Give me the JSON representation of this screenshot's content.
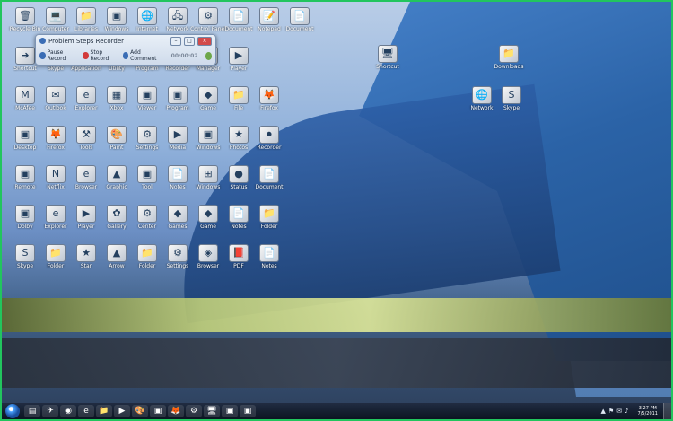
{
  "desktop": {
    "icons": [
      {
        "label": "Recycle Bin",
        "glyph": "🗑"
      },
      {
        "label": "Computer",
        "glyph": "💻"
      },
      {
        "label": "Libraries",
        "glyph": "📁"
      },
      {
        "label": "Windows",
        "glyph": "▣"
      },
      {
        "label": "Internet",
        "glyph": "🌐"
      },
      {
        "label": "Network",
        "glyph": "🖧"
      },
      {
        "label": "Control Panel",
        "glyph": "⚙"
      },
      {
        "label": "Document",
        "glyph": "📄"
      },
      {
        "label": "Notepad",
        "glyph": "📝"
      },
      {
        "label": "Document",
        "glyph": "📄"
      },
      {
        "label": "Shortcut",
        "glyph": "➜"
      },
      {
        "label": "Skype",
        "glyph": "S"
      },
      {
        "label": "Application",
        "glyph": "▣"
      },
      {
        "label": "Utility",
        "glyph": "⚙"
      },
      {
        "label": "Program",
        "glyph": "▣"
      },
      {
        "label": "Recorder",
        "glyph": "⏺"
      },
      {
        "label": "Manager",
        "glyph": "▣"
      },
      {
        "label": "Player",
        "glyph": "▶"
      },
      {
        "label": "McAfee",
        "glyph": "M"
      },
      {
        "label": "Outlook",
        "glyph": "✉"
      },
      {
        "label": "Explorer",
        "glyph": "e"
      },
      {
        "label": "Xbox",
        "glyph": "▦"
      },
      {
        "label": "Viewer",
        "glyph": "▣"
      },
      {
        "label": "Program",
        "glyph": "▣"
      },
      {
        "label": "Game",
        "glyph": "◆"
      },
      {
        "label": "File",
        "glyph": "📁"
      },
      {
        "label": "Firefox",
        "glyph": "🦊"
      },
      {
        "label": "Desktop",
        "glyph": "▣"
      },
      {
        "label": "Firefox",
        "glyph": "🦊"
      },
      {
        "label": "Tools",
        "glyph": "⚒"
      },
      {
        "label": "Paint",
        "glyph": "🎨"
      },
      {
        "label": "Settings",
        "glyph": "⚙"
      },
      {
        "label": "Media",
        "glyph": "▶"
      },
      {
        "label": "Windows",
        "glyph": "▣"
      },
      {
        "label": "Photos",
        "glyph": "★"
      },
      {
        "label": "Recorder",
        "glyph": "⏺"
      },
      {
        "label": "Remote",
        "glyph": "▣"
      },
      {
        "label": "Netflix",
        "glyph": "N"
      },
      {
        "label": "Browser",
        "glyph": "e"
      },
      {
        "label": "Graphic",
        "glyph": "▲"
      },
      {
        "label": "Tool",
        "glyph": "▣"
      },
      {
        "label": "Notes",
        "glyph": "📄"
      },
      {
        "label": "Windows",
        "glyph": "⊞"
      },
      {
        "label": "Status",
        "glyph": "●"
      },
      {
        "label": "Document",
        "glyph": "📄"
      },
      {
        "label": "Dolby",
        "glyph": "▣"
      },
      {
        "label": "Explorer",
        "glyph": "e"
      },
      {
        "label": "Player",
        "glyph": "▶"
      },
      {
        "label": "Gallery",
        "glyph": "✿"
      },
      {
        "label": "Center",
        "glyph": "⚙"
      },
      {
        "label": "Games",
        "glyph": "◆"
      },
      {
        "label": "Game",
        "glyph": "◆"
      },
      {
        "label": "Notes",
        "glyph": "📄"
      },
      {
        "label": "Folder",
        "glyph": "📁"
      },
      {
        "label": "Skype",
        "glyph": "S"
      },
      {
        "label": "Folder",
        "glyph": "📁"
      },
      {
        "label": "Star",
        "glyph": "★"
      },
      {
        "label": "Arrow",
        "glyph": "▲"
      },
      {
        "label": "Folder",
        "glyph": "📁"
      },
      {
        "label": "Settings",
        "glyph": "⚙"
      },
      {
        "label": "Browser",
        "glyph": "◈"
      },
      {
        "label": "PDF",
        "glyph": "📕"
      },
      {
        "label": "Notes",
        "glyph": "📄"
      }
    ],
    "right_icons": [
      {
        "label": "Shortcut",
        "glyph": "🖥"
      },
      {
        "label": "Downloads",
        "glyph": "📁"
      },
      {
        "label": "Network",
        "glyph": "🌐"
      },
      {
        "label": "Skype",
        "glyph": "S"
      }
    ]
  },
  "psr_window": {
    "title": "Problem Steps Recorder",
    "minimize": "–",
    "maximize": "□",
    "close": "×",
    "pause": "Pause Record",
    "stop": "Stop Record",
    "add_comment": "Add Comment",
    "timer": "00:00:02"
  },
  "taskbar": {
    "buttons": [
      "▤",
      "✈",
      "◉",
      "e",
      "📁",
      "▶",
      "🎨",
      "▣",
      "🦊",
      "⚙",
      "🖥",
      "▣",
      "▣"
    ],
    "tray_icons": [
      "▲",
      "⚑",
      "✉",
      "♪"
    ],
    "time": "3:27 PM",
    "date": "7/5/2011"
  }
}
